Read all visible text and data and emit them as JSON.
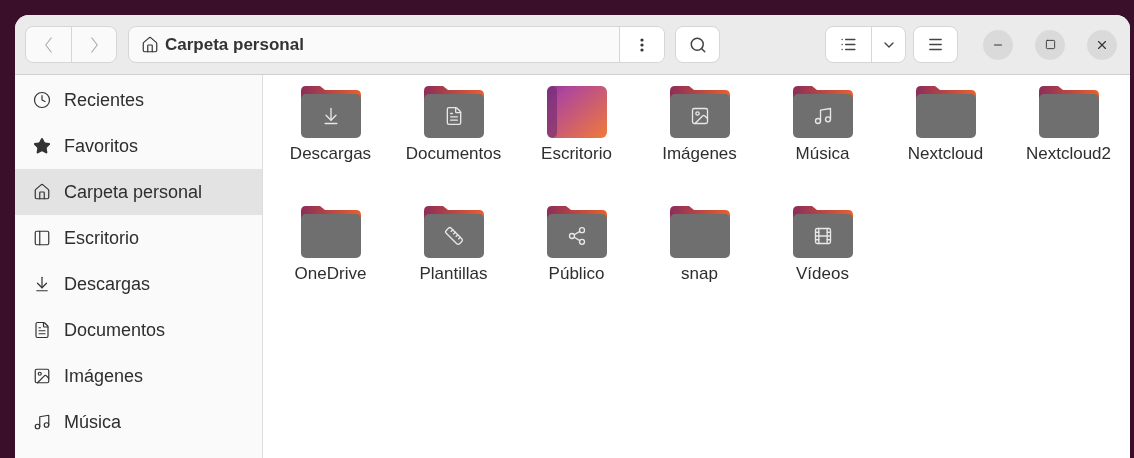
{
  "header": {
    "path": "Carpeta personal"
  },
  "sidebar": {
    "items": [
      {
        "label": "Recientes",
        "kind": "recent",
        "selected": false
      },
      {
        "label": "Favoritos",
        "kind": "starred",
        "selected": false
      },
      {
        "label": "Carpeta personal",
        "kind": "home",
        "selected": true
      },
      {
        "label": "Escritorio",
        "kind": "desktop",
        "selected": false
      },
      {
        "label": "Descargas",
        "kind": "downloads",
        "selected": false
      },
      {
        "label": "Documentos",
        "kind": "documents",
        "selected": false
      },
      {
        "label": "Imágenes",
        "kind": "pictures",
        "selected": false
      },
      {
        "label": "Música",
        "kind": "music",
        "selected": false
      }
    ]
  },
  "folders": [
    {
      "name": "Descargas",
      "kind": "downloads"
    },
    {
      "name": "Documentos",
      "kind": "documents"
    },
    {
      "name": "Escritorio",
      "kind": "desktop"
    },
    {
      "name": "Imágenes",
      "kind": "pictures"
    },
    {
      "name": "Música",
      "kind": "music"
    },
    {
      "name": "Nextcloud",
      "kind": "plain"
    },
    {
      "name": "Nextcloud2",
      "kind": "plain"
    },
    {
      "name": "OneDrive",
      "kind": "plain"
    },
    {
      "name": "Plantillas",
      "kind": "templates"
    },
    {
      "name": "Público",
      "kind": "public"
    },
    {
      "name": "snap",
      "kind": "plain"
    },
    {
      "name": "Vídeos",
      "kind": "videos"
    }
  ]
}
